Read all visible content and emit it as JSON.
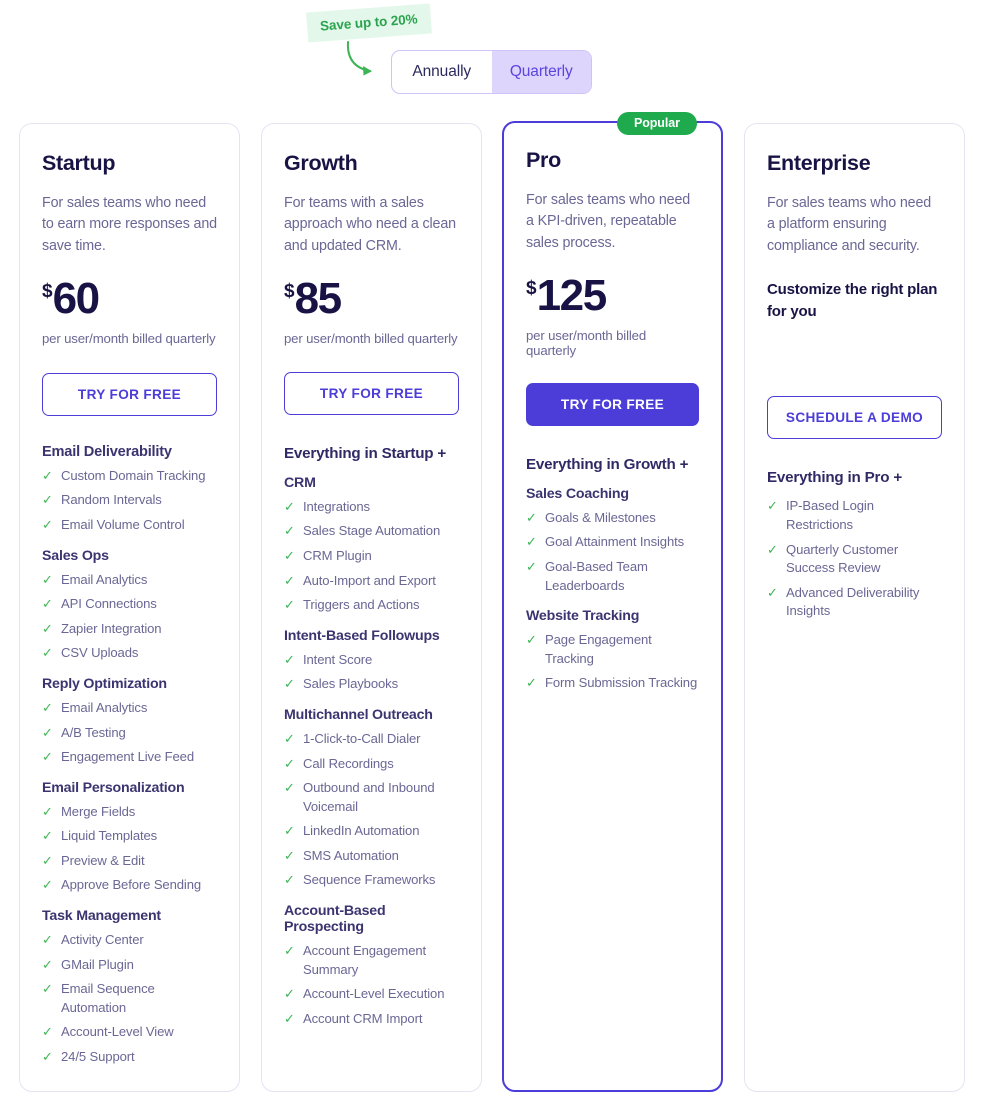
{
  "promo": {
    "badge_text": "Save up to 20%",
    "badge_bg": "#e3f7ea",
    "badge_color": "#2ba44f",
    "arrow_color": "#3cb554"
  },
  "billing_toggle": {
    "options": [
      {
        "label": "Annually",
        "active": false
      },
      {
        "label": "Quarterly",
        "active": true
      }
    ],
    "active_bg": "#ddd5fb",
    "active_color": "#5b44e0"
  },
  "popular_badge": {
    "label": "Popular",
    "bg": "#1faa4d",
    "color": "#ffffff"
  },
  "colors": {
    "accent": "#4c3dd8",
    "heading": "#181344",
    "body_text": "#6b6795",
    "check_green": "#3cb554",
    "card_border": "#e6e3f2"
  },
  "plans": [
    {
      "name": "Startup",
      "description": "For sales teams who need to earn more responses and save time.",
      "currency": "$",
      "price": "60",
      "price_note": "per user/month billed quarterly",
      "cta": "TRY FOR FREE",
      "cta_style": "outline",
      "highlighted": false,
      "sections": [
        {
          "heading": "Email Deliverability",
          "heading_style": "bold",
          "items": [
            "Custom Domain Tracking",
            "Random Intervals",
            "Email Volume Control"
          ]
        },
        {
          "heading": "Sales Ops",
          "heading_style": "bold",
          "items": [
            "Email Analytics",
            "API Connections",
            "Zapier Integration",
            "CSV Uploads"
          ]
        },
        {
          "heading": "Reply Optimization",
          "heading_style": "bold",
          "items": [
            "Email Analytics",
            "A/B Testing",
            "Engagement Live Feed"
          ]
        },
        {
          "heading": "Email Personalization",
          "heading_style": "bold",
          "items": [
            "Merge Fields",
            "Liquid Templates",
            "Preview & Edit",
            "Approve Before Sending"
          ]
        },
        {
          "heading": "Task Management",
          "heading_style": "bold",
          "items": [
            "Activity Center",
            "GMail Plugin",
            "Email Sequence Automation",
            "Account-Level View",
            "24/5 Support"
          ]
        }
      ]
    },
    {
      "name": "Growth",
      "description": "For teams with a sales approach who need a clean and updated CRM.",
      "currency": "$",
      "price": "85",
      "price_note": "per user/month billed quarterly",
      "cta": "TRY FOR FREE",
      "cta_style": "outline",
      "highlighted": false,
      "inherits": "Everything in Startup +",
      "sections": [
        {
          "heading": "CRM",
          "heading_style": "bold",
          "items": [
            "Integrations",
            "Sales Stage Automation",
            "CRM Plugin",
            "Auto-Import and Export",
            "Triggers and Actions"
          ]
        },
        {
          "heading": "Intent-Based Followups",
          "heading_style": "bold",
          "items": [
            "Intent Score",
            "Sales Playbooks"
          ]
        },
        {
          "heading": "Multichannel Outreach",
          "heading_style": "bold",
          "items": [
            "1-Click-to-Call Dialer",
            "Call Recordings",
            "Outbound and Inbound Voicemail",
            "LinkedIn Automation",
            "SMS Automation",
            "Sequence Frameworks"
          ]
        },
        {
          "heading": "Account-Based Prospecting",
          "heading_style": "bold",
          "items": [
            "Account Engagement Summary",
            "Account-Level Execution",
            "Account CRM Import"
          ]
        }
      ]
    },
    {
      "name": "Pro",
      "description": "For sales teams who need a KPI-driven, repeatable sales process.",
      "currency": "$",
      "price": "125",
      "price_note": "per user/month billed quarterly",
      "cta": "TRY FOR FREE",
      "cta_style": "filled",
      "highlighted": true,
      "inherits": "Everything in Growth +",
      "sections": [
        {
          "heading": "Sales Coaching",
          "heading_style": "bold",
          "items": [
            "Goals & Milestones",
            "Goal Attainment Insights",
            "Goal-Based Team Leaderboards"
          ]
        },
        {
          "heading": "Website Tracking",
          "heading_style": "bold",
          "items": [
            "Page Engagement Tracking",
            "Form Submission Tracking"
          ]
        }
      ]
    },
    {
      "name": "Enterprise",
      "description": "For sales teams who need a platform ensuring compliance and security.",
      "custom_note": "Customize the right plan for you",
      "cta": "SCHEDULE A DEMO",
      "cta_style": "outline",
      "highlighted": false,
      "inherits": "Everything in Pro +",
      "sections": [
        {
          "heading": null,
          "items": [
            "IP-Based Login Restrictions",
            "Quarterly Customer Success Review",
            "Advanced Deliverability Insights"
          ]
        }
      ]
    }
  ],
  "icons": {
    "check": "✓"
  }
}
